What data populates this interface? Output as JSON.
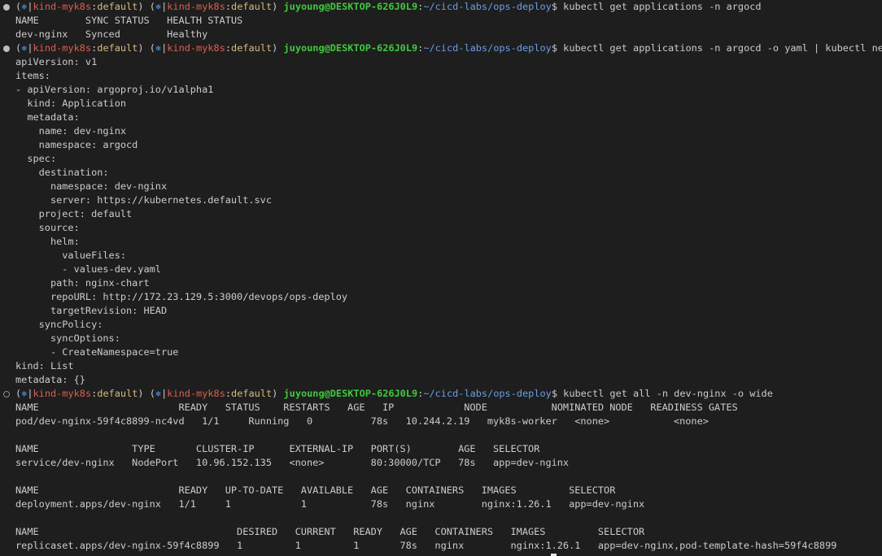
{
  "prompt": {
    "open_paren": "(",
    "k8s_icon": "⎈",
    "sep": "|",
    "context": "kind-myk8s",
    "colon": ":",
    "namespace": "default",
    "close_paren": ")",
    "space": " ",
    "user_host": "juyoung@DESKTOP-626J0L9",
    "path": "~/cicd-labs/ops-deploy",
    "dollar": "$ "
  },
  "commands": [
    "kubectl get applications -n argocd",
    "kubectl get applications -n argocd -o yaml | kubectl neat",
    "kubectl get all -n dev-nginx -o wide"
  ],
  "output_lines": [
    "NAME        SYNC STATUS   HEALTH STATUS",
    "dev-nginx   Synced        Healthy",
    "apiVersion: v1",
    "items:",
    "- apiVersion: argoproj.io/v1alpha1",
    "  kind: Application",
    "  metadata:",
    "    name: dev-nginx",
    "    namespace: argocd",
    "  spec:",
    "    destination:",
    "      namespace: dev-nginx",
    "      server: https://kubernetes.default.svc",
    "    project: default",
    "    source:",
    "      helm:",
    "        valueFiles:",
    "        - values-dev.yaml",
    "      path: nginx-chart",
    "      repoURL: http://172.23.129.5:3000/devops/ops-deploy",
    "      targetRevision: HEAD",
    "    syncPolicy:",
    "      syncOptions:",
    "      - CreateNamespace=true",
    "kind: List",
    "metadata: {}",
    "NAME                        READY   STATUS    RESTARTS   AGE   IP            NODE           NOMINATED NODE   READINESS GATES",
    "pod/dev-nginx-59f4c8899-nc4vd   1/1     Running   0          78s   10.244.2.19   myk8s-worker   <none>           <none>",
    "",
    "NAME                TYPE       CLUSTER-IP      EXTERNAL-IP   PORT(S)        AGE   SELECTOR",
    "service/dev-nginx   NodePort   10.96.152.135   <none>        80:30000/TCP   78s   app=dev-nginx",
    "",
    "NAME                        READY   UP-TO-DATE   AVAILABLE   AGE   CONTAINERS   IMAGES         SELECTOR",
    "deployment.apps/dev-nginx   1/1     1            1           78s   nginx        nginx:1.26.1   app=dev-nginx",
    "",
    "NAME                                  DESIRED   CURRENT   READY   AGE   CONTAINERS   IMAGES         SELECTOR",
    "replicaset.apps/dev-nginx-59f4c8899   1         1         1       78s   nginx        nginx:1.26.1   app=dev-nginx,pod-template-hash=59f4c8899"
  ],
  "colors": {
    "background": "#1e1e1e",
    "text": "#cccccc",
    "context": "#d8604e",
    "namespace": "#d7ba7d",
    "user_host": "#3fc93f",
    "path": "#6a9fe8",
    "k8s_icon": "#4d8fd6"
  },
  "icons": {
    "prompt_marker": "circle-dot-icon",
    "kube_context": "kubernetes-helm-icon"
  }
}
